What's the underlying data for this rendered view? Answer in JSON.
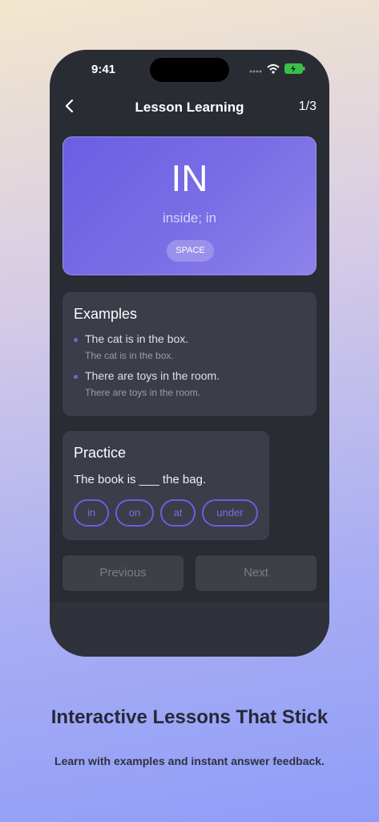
{
  "status_bar": {
    "time": "9:41"
  },
  "nav": {
    "title": "Lesson Learning",
    "progress": "1/3"
  },
  "word_card": {
    "word": "IN",
    "meaning": "inside; in",
    "tag": "SPACE"
  },
  "examples": {
    "title": "Examples",
    "items": [
      {
        "sentence": "The cat is in the box.",
        "translation": "The cat is in the box."
      },
      {
        "sentence": "There are toys in the room.",
        "translation": "There are toys in the room."
      }
    ]
  },
  "practice": {
    "title": "Practice",
    "question": "The book is ___ the bag.",
    "options": [
      "in",
      "on",
      "at",
      "under"
    ]
  },
  "buttons": {
    "previous": "Previous",
    "next": "Next"
  },
  "promo": {
    "headline": "Interactive Lessons That Stick",
    "subline": "Learn with examples and instant answer feedback."
  },
  "colors": {
    "accent": "#6b5ee3",
    "card_bg": "#3b3d48",
    "phone_bg": "#2a2c34"
  }
}
